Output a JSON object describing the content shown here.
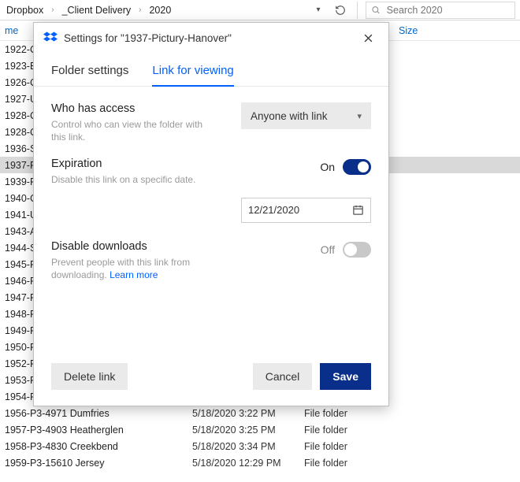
{
  "breadcrumb": {
    "items": [
      "Dropbox",
      "_Client Delivery",
      "2020"
    ]
  },
  "search": {
    "placeholder": "Search 2020"
  },
  "columns": {
    "name": "me",
    "date": "",
    "type": "",
    "size": "Size"
  },
  "folders": [
    {
      "name": "1922-C",
      "date": "",
      "type": "",
      "selected": false
    },
    {
      "name": "1923-B",
      "date": "",
      "type": "",
      "selected": false
    },
    {
      "name": "1926-C",
      "date": "",
      "type": "",
      "selected": false
    },
    {
      "name": "1927-U",
      "date": "",
      "type": "",
      "selected": false
    },
    {
      "name": "1928-C",
      "date": "",
      "type": "",
      "selected": false
    },
    {
      "name": "1928-C",
      "date": "",
      "type": "",
      "selected": false
    },
    {
      "name": "1936-S",
      "date": "",
      "type": "",
      "selected": false
    },
    {
      "name": "1937-P",
      "date": "",
      "type": "",
      "selected": true
    },
    {
      "name": "1939-R",
      "date": "",
      "type": "",
      "selected": false
    },
    {
      "name": "1940-C",
      "date": "",
      "type": "",
      "selected": false
    },
    {
      "name": "1941-U",
      "date": "",
      "type": "",
      "selected": false
    },
    {
      "name": "1943-A",
      "date": "",
      "type": "",
      "selected": false
    },
    {
      "name": "1944-S",
      "date": "",
      "type": "",
      "selected": false
    },
    {
      "name": "1945-P",
      "date": "",
      "type": "",
      "selected": false
    },
    {
      "name": "1946-P",
      "date": "",
      "type": "",
      "selected": false
    },
    {
      "name": "1947-P",
      "date": "",
      "type": "",
      "selected": false
    },
    {
      "name": "1948-P",
      "date": "",
      "type": "",
      "selected": false
    },
    {
      "name": "1949-P",
      "date": "",
      "type": "",
      "selected": false
    },
    {
      "name": "1950-P",
      "date": "",
      "type": "",
      "selected": false
    },
    {
      "name": "1952-P",
      "date": "",
      "type": "",
      "selected": false
    },
    {
      "name": "1953-P",
      "date": "",
      "type": "",
      "selected": false
    },
    {
      "name": "1954-P",
      "date": "",
      "type": "",
      "selected": false
    },
    {
      "name": "1956-P3-4971 Dumfries",
      "date": "5/18/2020 3:22 PM",
      "type": "File folder",
      "selected": false
    },
    {
      "name": "1957-P3-4903 Heatherglen",
      "date": "5/18/2020 3:25 PM",
      "type": "File folder",
      "selected": false
    },
    {
      "name": "1958-P3-4830 Creekbend",
      "date": "5/18/2020 3:34 PM",
      "type": "File folder",
      "selected": false
    },
    {
      "name": "1959-P3-15610 Jersey",
      "date": "5/18/2020 12:29 PM",
      "type": "File folder",
      "selected": false
    }
  ],
  "modal": {
    "title": "Settings for \"1937-Pictury-Hanover\"",
    "tabs": {
      "folder": "Folder settings",
      "link": "Link for viewing"
    },
    "access": {
      "heading": "Who has access",
      "sub": "Control who can view the folder with this link.",
      "value": "Anyone with link"
    },
    "expiration": {
      "heading": "Expiration",
      "sub": "Disable this link on a specific date.",
      "state_label": "On",
      "date": "12/21/2020"
    },
    "downloads": {
      "heading": "Disable downloads",
      "sub": "Prevent people with this link from downloading. ",
      "learn_more": "Learn more",
      "state_label": "Off"
    },
    "buttons": {
      "delete": "Delete link",
      "cancel": "Cancel",
      "save": "Save"
    }
  }
}
